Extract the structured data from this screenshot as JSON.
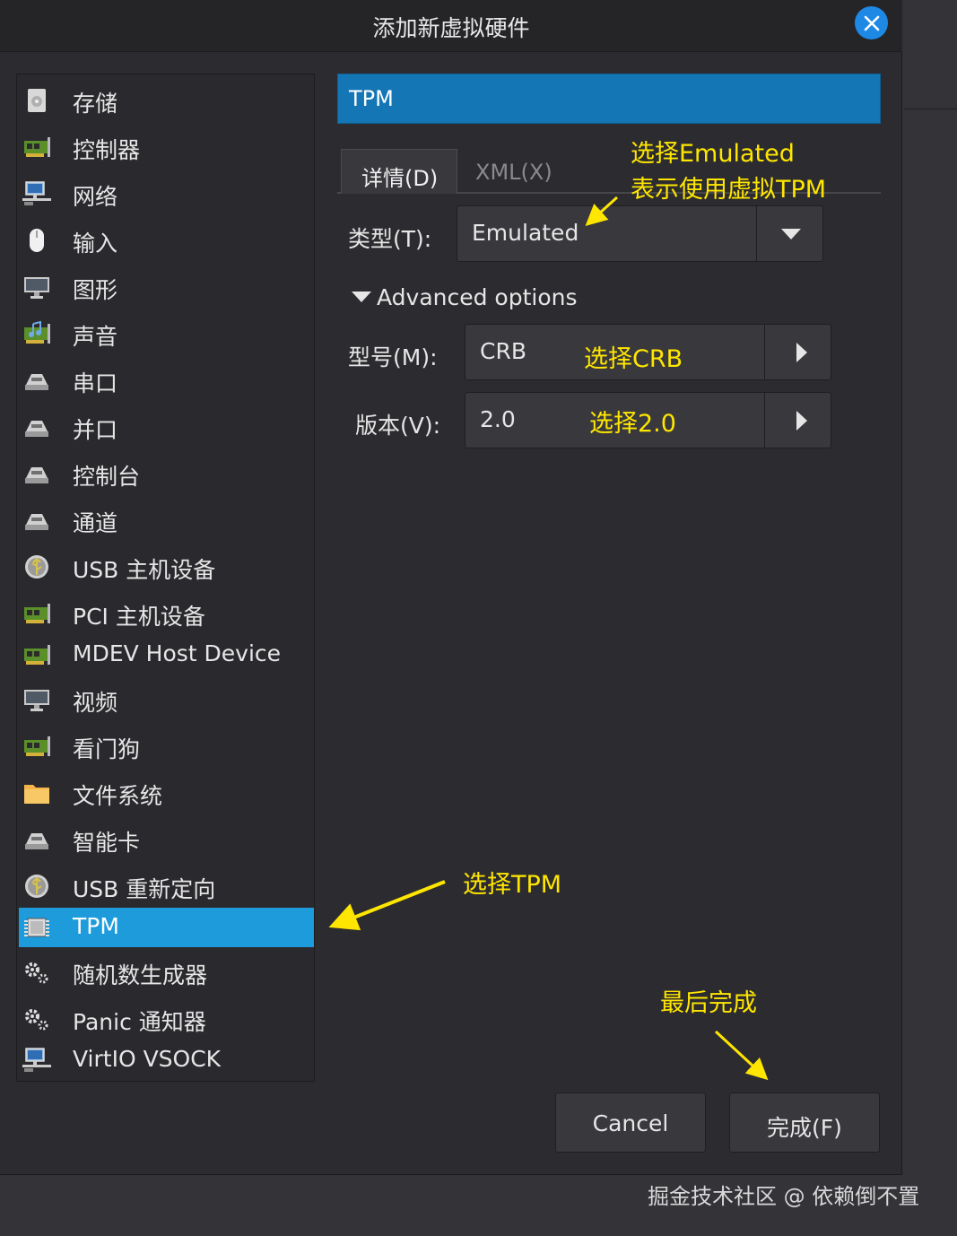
{
  "dialog": {
    "title": "添加新虚拟硬件",
    "close_icon": "close-icon"
  },
  "sidebar": {
    "items": [
      {
        "label": "存储",
        "icon": "storage-disk-icon"
      },
      {
        "label": "控制器",
        "icon": "pci-card-icon"
      },
      {
        "label": "网络",
        "icon": "network-icon"
      },
      {
        "label": "输入",
        "icon": "mouse-icon"
      },
      {
        "label": "图形",
        "icon": "monitor-icon"
      },
      {
        "label": "声音",
        "icon": "sound-card-icon"
      },
      {
        "label": "串口",
        "icon": "serial-port-icon"
      },
      {
        "label": "并口",
        "icon": "parallel-port-icon"
      },
      {
        "label": "控制台",
        "icon": "console-icon"
      },
      {
        "label": "通道",
        "icon": "channel-icon"
      },
      {
        "label": "USB 主机设备",
        "icon": "usb-icon"
      },
      {
        "label": "PCI 主机设备",
        "icon": "pci-card-icon"
      },
      {
        "label": "MDEV Host Device",
        "icon": "pci-card-icon"
      },
      {
        "label": "视频",
        "icon": "monitor-icon"
      },
      {
        "label": "看门狗",
        "icon": "pci-card-icon"
      },
      {
        "label": "文件系统",
        "icon": "folder-icon"
      },
      {
        "label": "智能卡",
        "icon": "smartcard-icon"
      },
      {
        "label": "USB 重新定向",
        "icon": "usb-icon"
      },
      {
        "label": "TPM",
        "icon": "chip-icon",
        "selected": true
      },
      {
        "label": "随机数生成器",
        "icon": "gear-icon"
      },
      {
        "label": "Panic 通知器",
        "icon": "gear-icon"
      },
      {
        "label": "VirtIO VSOCK",
        "icon": "network-icon"
      }
    ]
  },
  "panel": {
    "header": "TPM",
    "tabs": [
      {
        "label": "详情(D)",
        "active": true
      },
      {
        "label": "XML(X)",
        "active": false
      }
    ],
    "type_label": "类型(T):",
    "type_value": "Emulated",
    "advanced_label": "Advanced options",
    "model_label": "型号(M):",
    "model_value": "CRB",
    "version_label": "版本(V):",
    "version_value": "2.0"
  },
  "buttons": {
    "cancel": "Cancel",
    "finish": "完成(F)"
  },
  "annotations": {
    "emulated_line1": "选择Emulated",
    "emulated_line2": "表示使用虚拟TPM",
    "crb": "选择CRB",
    "v20": "选择2.0",
    "tpm": "选择TPM",
    "finish": "最后完成",
    "color": "#ffe600"
  },
  "watermark": "掘金技术社区 @ 依赖倒不置"
}
